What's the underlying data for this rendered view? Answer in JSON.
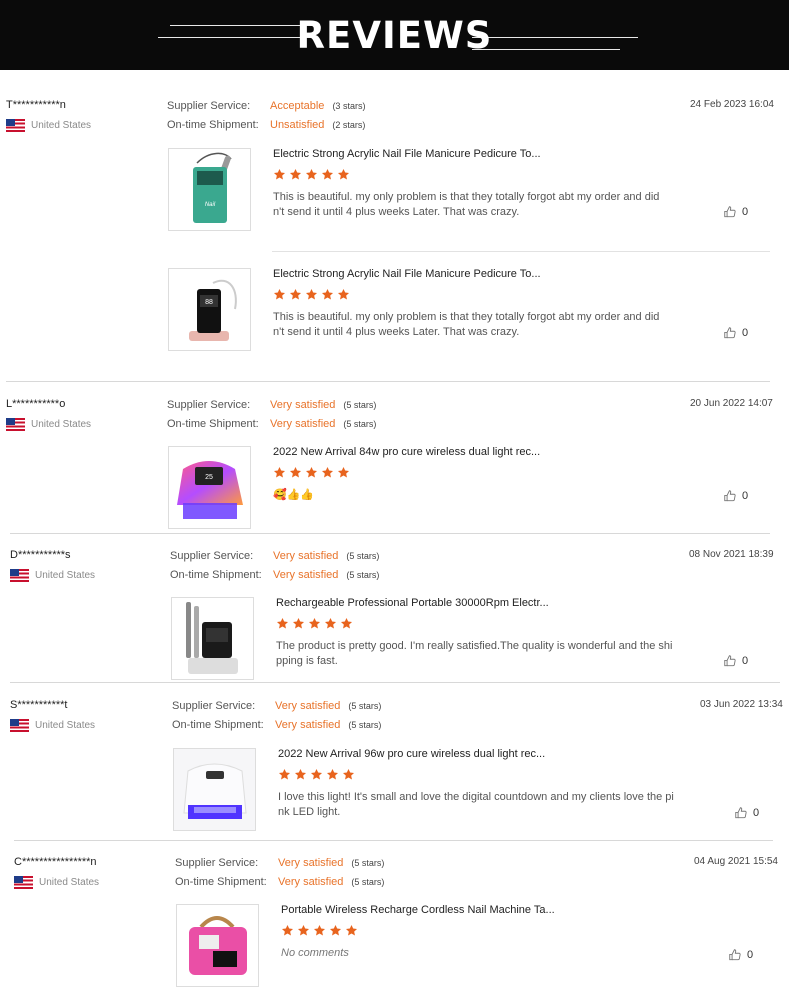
{
  "page": {
    "title": "REVIEWS"
  },
  "labels": {
    "supplier_service": "Supplier Service:",
    "ontime_shipment": "On-time Shipment:"
  },
  "colors": {
    "accent": "#e8732a",
    "header_bg": "#0a0a0a",
    "star": "#e8641e"
  },
  "reviews": [
    {
      "user": "T***********n",
      "country": "United States",
      "date": "24 Feb 2023 16:04",
      "supplier": {
        "value": "Acceptable",
        "stars_text": "(3 stars)"
      },
      "shipment": {
        "value": "Unsatisfied",
        "stars_text": "(2 stars)"
      },
      "products": [
        {
          "name": "Electric Strong Acrylic Nail File Manicure Pedicure To...",
          "rating": 5,
          "comment": "This is beautiful. my only problem is that they totally forgot abt my order and did n't send it until 4 plus weeks Later. That was crazy.",
          "likes": "0",
          "image": "teal-nail-drill"
        },
        {
          "name": "Electric Strong Acrylic Nail File Manicure Pedicure To...",
          "rating": 5,
          "comment": "This is beautiful. my only problem is that they totally forgot abt my order and did n't send it until 4 plus weeks Later. That was crazy.",
          "likes": "0",
          "image": "pink-nail-drill"
        }
      ]
    },
    {
      "user": "L***********o",
      "country": "United States",
      "date": "20 Jun 2022 14:07",
      "supplier": {
        "value": "Very satisfied",
        "stars_text": "(5 stars)"
      },
      "shipment": {
        "value": "Very satisfied",
        "stars_text": "(5 stars)"
      },
      "products": [
        {
          "name": "2022 New Arrival 84w pro cure wireless dual light rec...",
          "rating": 5,
          "comment": "🥰👍👍",
          "likes": "0",
          "image": "rainbow-uv-lamp"
        }
      ]
    },
    {
      "user": "D***********s",
      "country": "United States",
      "date": "08 Nov 2021 18:39",
      "supplier": {
        "value": "Very satisfied",
        "stars_text": "(5 stars)"
      },
      "shipment": {
        "value": "Very satisfied",
        "stars_text": "(5 stars)"
      },
      "products": [
        {
          "name": "Rechargeable Professional Portable 30000Rpm Electr...",
          "rating": 5,
          "comment": "The product is pretty good. I'm really satisfied.The quality is wonderful and the shi pping is fast.",
          "likes": "0",
          "image": "black-nail-drill"
        }
      ]
    },
    {
      "user": "S***********t",
      "country": "United States",
      "date": "03 Jun 2022 13:34",
      "supplier": {
        "value": "Very satisfied",
        "stars_text": "(5 stars)"
      },
      "shipment": {
        "value": "Very satisfied",
        "stars_text": "(5 stars)"
      },
      "products": [
        {
          "name": "2022 New Arrival 96w pro cure wireless dual light rec...",
          "rating": 5,
          "comment": "I love this light! It's small and love the digital countdown and my clients love the pi nk LED light.",
          "likes": "0",
          "image": "white-uv-lamp"
        }
      ]
    },
    {
      "user": "C****************n",
      "country": "United States",
      "date": "04 Aug 2021 15:54",
      "supplier": {
        "value": "Very satisfied",
        "stars_text": "(5 stars)"
      },
      "shipment": {
        "value": "Very satisfied",
        "stars_text": "(5 stars)"
      },
      "products": [
        {
          "name": "Portable Wireless Recharge Cordless Nail Machine Ta...",
          "rating": 5,
          "comment": "No comments",
          "comment_empty": true,
          "likes": "0",
          "image": "pink-nail-machine"
        }
      ]
    }
  ]
}
